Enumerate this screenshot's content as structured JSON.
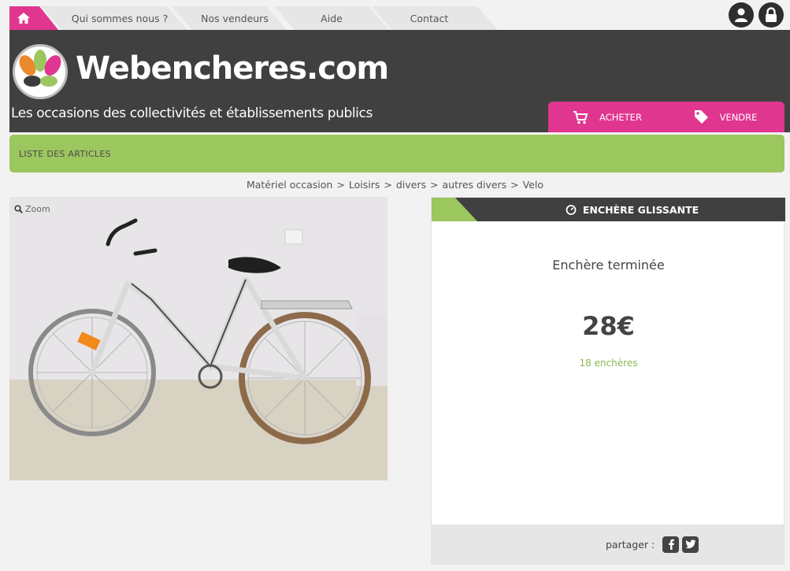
{
  "nav": {
    "home_icon": "home-icon",
    "links": [
      "Qui sommes nous ?",
      "Nos vendeurs",
      "Aide",
      "Contact"
    ],
    "account_icons": [
      "user-icon",
      "lock-icon"
    ]
  },
  "header": {
    "brand": "Webencheres.com",
    "tagline": "Les occasions des collectivités et établissements publics",
    "buy_label": "ACHETER",
    "sell_label": "VENDRE"
  },
  "green_bar": {
    "label": "LISTE DES ARTICLES"
  },
  "breadcrumb": [
    "Matériel occasion",
    "Loisirs",
    "divers",
    "autres divers",
    "Velo"
  ],
  "photo": {
    "zoom_label": "Zoom"
  },
  "auction": {
    "type": "ENCHÈRE GLISSANTE",
    "status": "Enchère terminée",
    "price": "28€",
    "bids": "18 enchères",
    "share_label": "partager :"
  },
  "colors": {
    "pink": "#e0368f",
    "green": "#9cc65e",
    "dark": "#404040"
  }
}
